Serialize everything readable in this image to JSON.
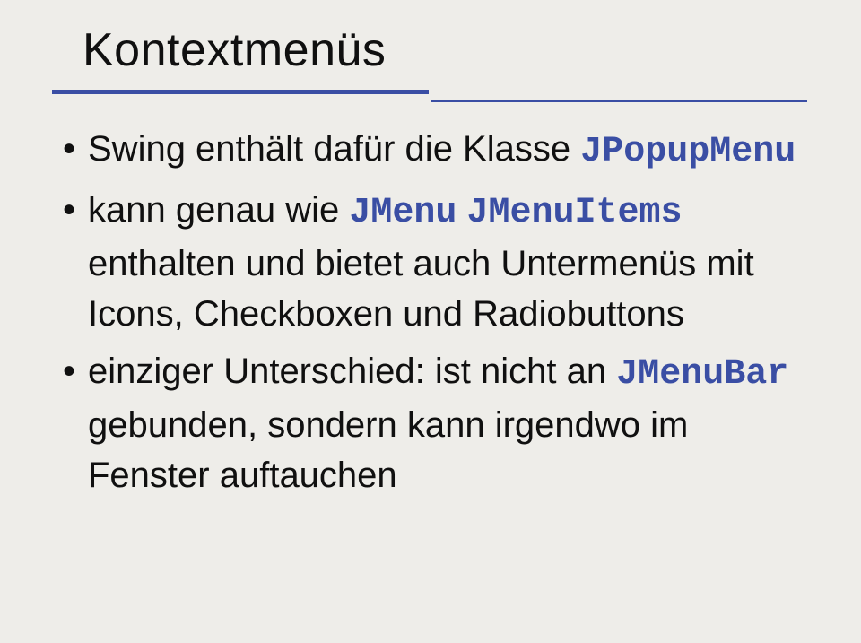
{
  "title": "Kontextmenüs",
  "bullets": [
    {
      "runs": [
        {
          "t": "Swing enthält dafür die Klasse "
        },
        {
          "t": "JPopupMenu",
          "mono": true
        }
      ]
    },
    {
      "runs": [
        {
          "t": "kann genau wie "
        },
        {
          "t": "JMenu",
          "mono": true
        },
        {
          "t": " "
        },
        {
          "t": "JMenuItems",
          "mono": true
        },
        {
          "t": " enthalten und bietet auch Untermenüs mit Icons, Checkboxen und Radiobuttons"
        }
      ]
    },
    {
      "runs": [
        {
          "t": "einziger Unterschied: ist nicht an "
        },
        {
          "t": "JMenuBar",
          "mono": true
        },
        {
          "t": " gebunden, sondern kann irgendwo im Fenster auftauchen"
        }
      ]
    }
  ]
}
